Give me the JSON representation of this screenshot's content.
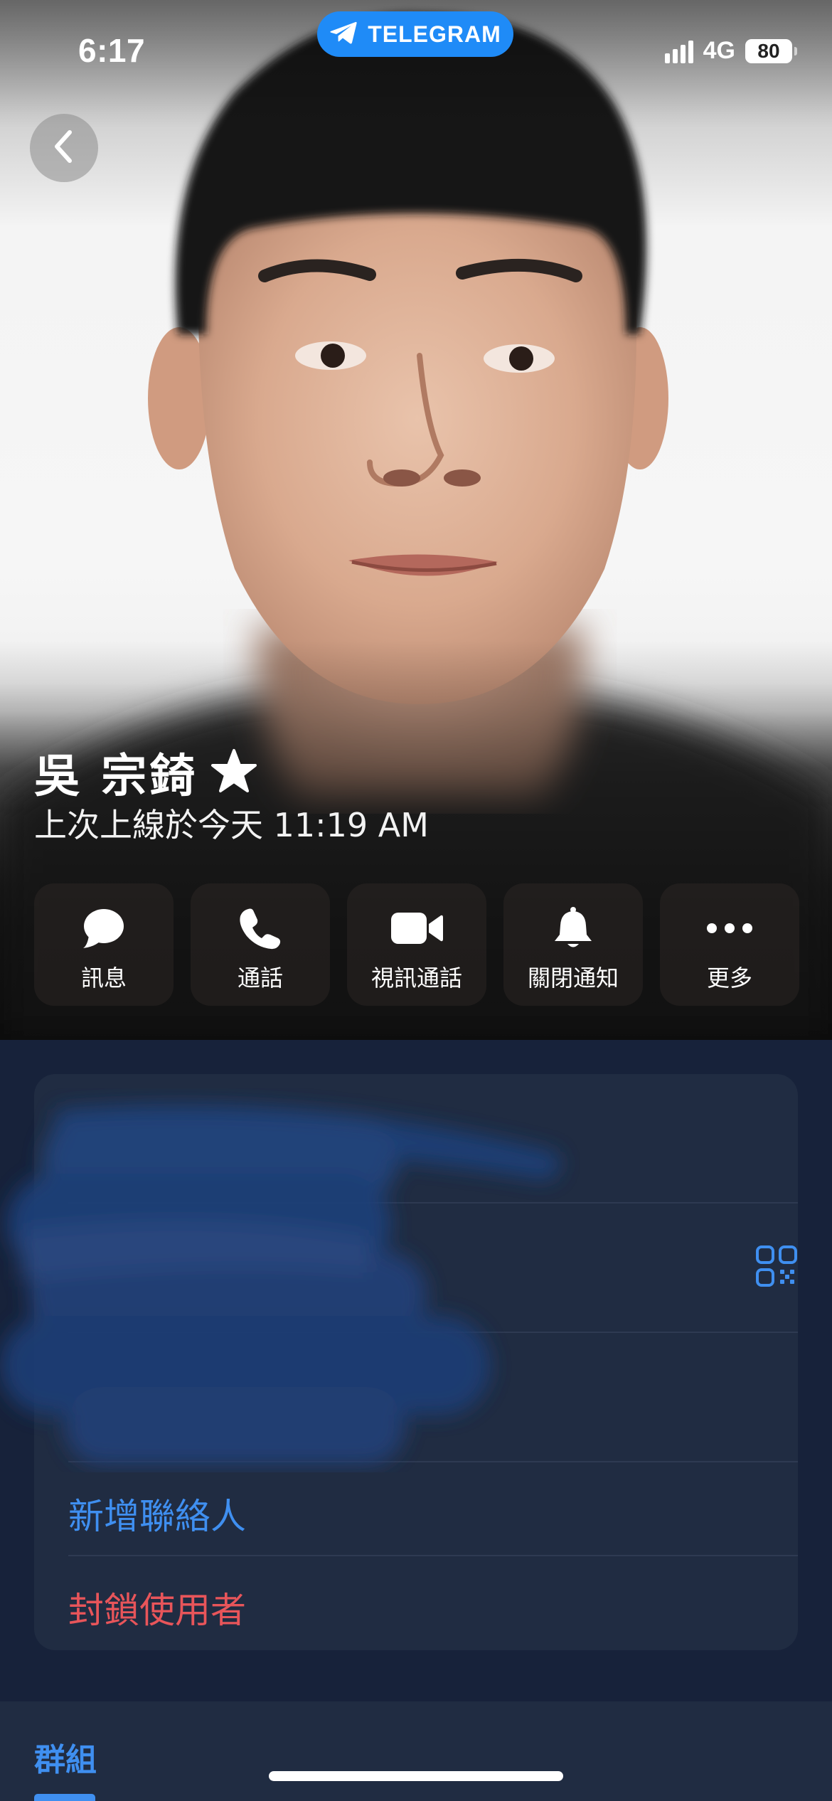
{
  "status_bar": {
    "time": "6:17",
    "app_pill": "TELEGRAM",
    "network": "4G",
    "battery": "80"
  },
  "profile": {
    "name": "吳 宗錡",
    "last_seen": "上次上線於今天 11:19 AM"
  },
  "actions": [
    {
      "label": "訊息",
      "icon": "message-icon"
    },
    {
      "label": "通話",
      "icon": "phone-icon"
    },
    {
      "label": "視訊通話",
      "icon": "video-icon"
    },
    {
      "label": "關閉通知",
      "icon": "bell-icon"
    },
    {
      "label": "更多",
      "icon": "more-icon"
    }
  ],
  "info_card": {
    "add_contact": "新增聯絡人",
    "block_user": "封鎖使用者"
  },
  "groups": {
    "title": "群組"
  },
  "colors": {
    "accent_blue": "#3f8ff0",
    "danger_red": "#e8555a",
    "telegram_blue": "#1f8bf7",
    "card_bg": "#202c42",
    "page_bg": "#17223a"
  }
}
